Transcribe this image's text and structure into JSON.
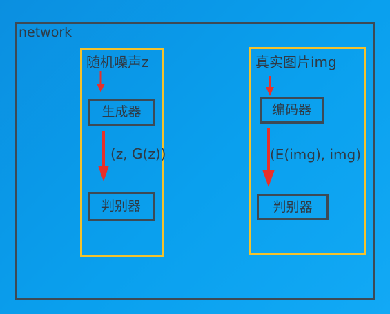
{
  "network_label": "network",
  "left_panel": {
    "input_label": "随机噪声z",
    "top_node": "生成器",
    "edge_label": "(z, G(z))",
    "bottom_node": "判别器"
  },
  "right_panel": {
    "input_label": "真实图片img",
    "top_node": "编码器",
    "edge_label": "(E(img), img)",
    "bottom_node": "判别器"
  },
  "colors": {
    "background": "#0aa0ee",
    "network_border": "#3d4a55",
    "group_border": "#f4c22b",
    "arrow": "#e8302a",
    "text": "#2f3a45"
  }
}
